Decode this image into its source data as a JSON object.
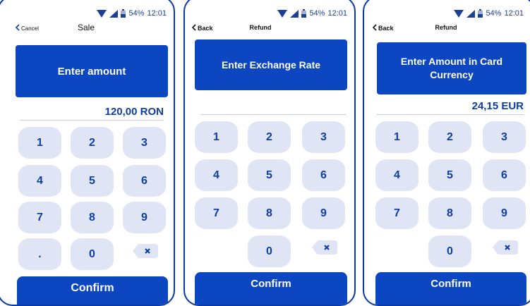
{
  "status": {
    "battery": "54%",
    "time": "12:01"
  },
  "screens": [
    {
      "back_label": "Cancel",
      "title": "Sale",
      "prompt": "Enter amount",
      "amount": "120,00 RON",
      "keys": [
        "1",
        "2",
        "3",
        "4",
        "5",
        "6",
        "7",
        "8",
        "9",
        ".",
        "0"
      ],
      "confirm": "Confirm"
    },
    {
      "back_label": "Back",
      "title": "Refund",
      "prompt": "Enter Exchange Rate",
      "amount": "",
      "keys": [
        "1",
        "2",
        "3",
        "4",
        "5",
        "6",
        "7",
        "8",
        "9",
        "0"
      ],
      "confirm": "Confirm"
    },
    {
      "back_label": "Back",
      "title": "Refund",
      "prompt": "Enter Amount in Card Currency",
      "amount": "24,15 EUR",
      "keys": [
        "1",
        "2",
        "3",
        "4",
        "5",
        "6",
        "7",
        "8",
        "9",
        "0"
      ],
      "confirm": "Confirm"
    }
  ],
  "icons": {
    "back": "chevron-left-icon",
    "erase": "backspace-icon",
    "wifi": "wifi-icon",
    "signal": "signal-icon",
    "battery": "battery-icon"
  },
  "colors": {
    "primary": "#0c46c0",
    "key_bg": "#dfe5f4",
    "key_text": "#0c3ea6",
    "frame": "#0a3aa8"
  }
}
